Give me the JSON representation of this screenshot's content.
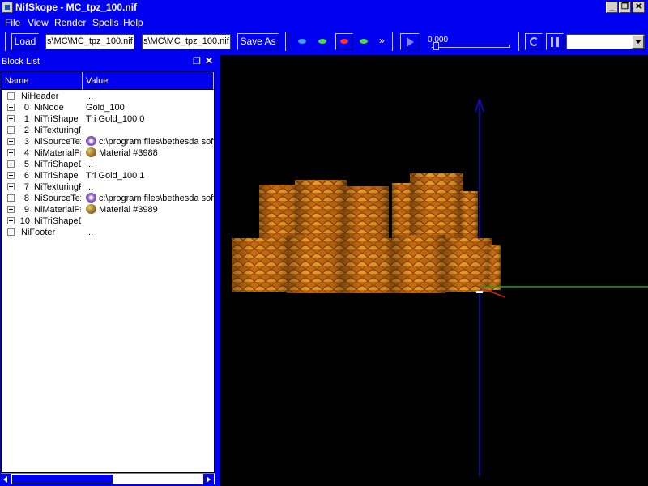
{
  "window": {
    "title": "NifSkope - MC_tpz_100.nif",
    "min": "_",
    "restore": "❐",
    "close": "✕"
  },
  "menu": [
    "File",
    "View",
    "Render",
    "Spells",
    "Help"
  ],
  "toolbar": {
    "load_label": "Load",
    "load_path": "s\\MC\\MC_tpz_100.nif",
    "save_path": "s\\MC\\MC_tpz_100.nif",
    "save_label": "Save As",
    "more": "»",
    "time": "0.000",
    "colors": {
      "eye_blue": "#40a0ff",
      "eye_green": "#40e040",
      "eye_red": "#ff3030"
    }
  },
  "block_list": {
    "title": "Block List",
    "col_name": "Name",
    "col_value": "Value",
    "rows": [
      {
        "index": "",
        "name": "NiHeader",
        "value": "...",
        "icon": ""
      },
      {
        "index": "0",
        "name": "NiNode",
        "value": "Gold_100",
        "icon": ""
      },
      {
        "index": "1",
        "name": "NiTriShape",
        "value": "Tri Gold_100 0",
        "icon": ""
      },
      {
        "index": "2",
        "name": "NiTexturingProperty",
        "value": "",
        "icon": ""
      },
      {
        "index": "3",
        "name": "NiSourceTexture",
        "value": "c:\\program files\\bethesda softworks",
        "icon": "texture-icon"
      },
      {
        "index": "4",
        "name": "NiMaterialProperty",
        "value": "Material #3988",
        "icon": "palette-icon"
      },
      {
        "index": "5",
        "name": "NiTriShapeData",
        "value": "...",
        "icon": ""
      },
      {
        "index": "6",
        "name": "NiTriShape",
        "value": "Tri Gold_100 1",
        "icon": ""
      },
      {
        "index": "7",
        "name": "NiTexturingProperty",
        "value": "...",
        "icon": ""
      },
      {
        "index": "8",
        "name": "NiSourceTexture",
        "value": "c:\\program files\\bethesda softworks",
        "icon": "texture-icon"
      },
      {
        "index": "9",
        "name": "NiMaterialProperty",
        "value": "Material #3989",
        "icon": "palette-icon"
      },
      {
        "index": "10",
        "name": "NiTriShapeData",
        "value": "",
        "icon": ""
      },
      {
        "index": "",
        "name": "NiFooter",
        "value": "...",
        "icon": ""
      }
    ]
  },
  "viewport": {
    "colors": {
      "background": "#000000",
      "axis_y": "#1010d0",
      "axis_x": "#20a020",
      "axis_z": "#d02020",
      "gold": "#c06010"
    }
  }
}
